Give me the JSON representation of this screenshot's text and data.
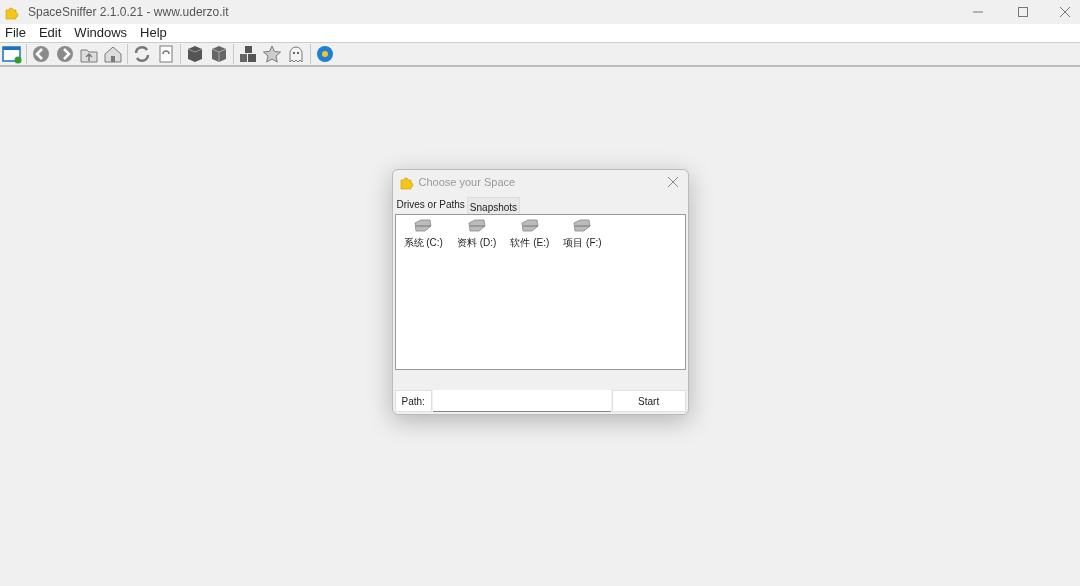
{
  "window": {
    "title": "SpaceSniffer 2.1.0.21 - www.uderzo.it"
  },
  "menu": [
    "File",
    "Edit",
    "Windows",
    "Help"
  ],
  "toolbar": [
    {
      "kind": "newwin"
    },
    {
      "kind": "sep"
    },
    {
      "kind": "back"
    },
    {
      "kind": "forward"
    },
    {
      "kind": "up"
    },
    {
      "kind": "home"
    },
    {
      "kind": "sep"
    },
    {
      "kind": "refresh"
    },
    {
      "kind": "refreshdoc"
    },
    {
      "kind": "sep"
    },
    {
      "kind": "cube"
    },
    {
      "kind": "cube2"
    },
    {
      "kind": "sep"
    },
    {
      "kind": "cubes"
    },
    {
      "kind": "star"
    },
    {
      "kind": "ghost"
    },
    {
      "kind": "sep"
    },
    {
      "kind": "globe"
    }
  ],
  "dialog": {
    "title": "Choose your Space",
    "tabs": [
      {
        "label": "Drives or Paths",
        "selected": true
      },
      {
        "label": "Snapshots",
        "selected": false
      }
    ],
    "drives": [
      "系统 (C:)",
      "资料 (D:)",
      "软件 (E:)",
      "项目 (F:)"
    ],
    "path_label": "Path:",
    "start": "Start"
  }
}
